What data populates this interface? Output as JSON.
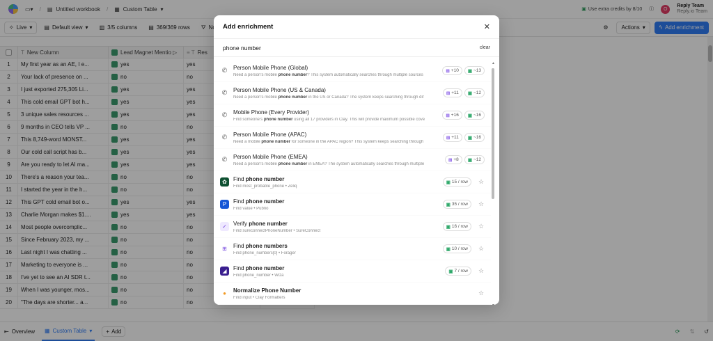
{
  "topbar": {
    "workbook": "Untitled workbook",
    "table": "Custom Table",
    "credits": "Use extra credits by 8/10",
    "account_name": "Reply Team",
    "account_sub": "Reply.io Team",
    "avatar_letter": "O"
  },
  "toolbar": {
    "live": "Live",
    "view": "Default view",
    "columns": "3/5 columns",
    "rows": "369/369 rows",
    "filter": "No f",
    "actions": "Actions",
    "add_enrichment": "Add enrichment"
  },
  "grid": {
    "headers": [
      "New Column",
      "Lead Magnet Mentio",
      "Res"
    ],
    "rows": [
      [
        "1",
        "My first year as an AE, I e...",
        "yes",
        "yes"
      ],
      [
        "2",
        "Your lack of presence on ...",
        "no",
        "no"
      ],
      [
        "3",
        "I just exported 275,305 Li...",
        "yes",
        "yes"
      ],
      [
        "4",
        "This cold email GPT bot h...",
        "yes",
        "yes"
      ],
      [
        "5",
        "3 unique sales resources ...",
        "yes",
        "yes"
      ],
      [
        "6",
        "9 months in CEO tells VP ...",
        "no",
        "no"
      ],
      [
        "7",
        "This 8,749-word MONST...",
        "yes",
        "yes"
      ],
      [
        "8",
        "Our cold call script has b...",
        "yes",
        "yes"
      ],
      [
        "9",
        "Are you ready to let AI ma...",
        "yes",
        "yes"
      ],
      [
        "10",
        "There's a reason your tea...",
        "no",
        "no"
      ],
      [
        "11",
        "I started the year in the h...",
        "no",
        "no"
      ],
      [
        "12",
        "This GPT cold email bot o...",
        "yes",
        "yes"
      ],
      [
        "13",
        "Charlie Morgan makes $1....",
        "yes",
        "yes"
      ],
      [
        "14",
        "Most people overcomplic...",
        "no",
        "no"
      ],
      [
        "15",
        "Since February 2023, my ...",
        "no",
        "no"
      ],
      [
        "16",
        "Last night I was chatting ...",
        "no",
        "no"
      ],
      [
        "17",
        "Marketing to everyone is ...",
        "no",
        "no"
      ],
      [
        "18",
        "I've yet to see an AI SDR t...",
        "no",
        "no"
      ],
      [
        "19",
        "When I was younger, mos...",
        "no",
        "no"
      ],
      [
        "20",
        "\"The days are shorter... a...",
        "no",
        "no"
      ]
    ]
  },
  "bottombar": {
    "overview": "Overview",
    "tab": "Custom Table",
    "add": "Add"
  },
  "modal": {
    "title": "Add enrichment",
    "search_value": "phone number",
    "clear": "clear",
    "items": [
      {
        "name": "Person Mobile Phone (Global)",
        "d1": "Need a person's mobile ",
        "dk": "phone number",
        "d2": "? This system automatically searches through multiple sources",
        "p1": "+10",
        "p2": "~13",
        "icon": "phone"
      },
      {
        "name": "Person Mobile Phone (US & Canada)",
        "d1": "Need a person's mobile ",
        "dk": "phone number",
        "d2": " in the US or Canada? The system keeps searching through dif",
        "p1": "+11",
        "p2": "~12",
        "icon": "phone"
      },
      {
        "name": "Mobile Phone (Every Provider)",
        "d1": "Find someone's ",
        "dk": "phone number",
        "d2": " using all 17 providers in Clay. This will provide maximum possible cove",
        "p1": "+16",
        "p2": "~16",
        "icon": "phone"
      },
      {
        "name": "Person Mobile Phone (APAC)",
        "d1": "Need a mobile ",
        "dk": "phone number",
        "d2": " for someone in the APAC region? This system keeps searching through",
        "p1": "+11",
        "p2": "~16",
        "icon": "phone"
      },
      {
        "name": "Person Mobile Phone (EMEA)",
        "d1": "Need a person's mobile ",
        "dk": "phone number",
        "d2": " in EMEA? The system automatically searches through multiple",
        "p1": "+8",
        "p2": "~12",
        "icon": "phone"
      },
      {
        "name_pre": "Find ",
        "name_k": "phone number",
        "desc": "Find most_probable_phone • Zeliq",
        "credits": "15 / row",
        "icon": "zeliq"
      },
      {
        "name_pre": "Find ",
        "name_k": "phone number",
        "desc": "Find value • Pubrio",
        "credits": "35 / row",
        "icon": "pubrio"
      },
      {
        "name_pre": "Verify ",
        "name_k": "phone number",
        "desc": "Find sureconnectPhoneNumber • SureConnect",
        "credits": "16 / row",
        "icon": "sureconnect"
      },
      {
        "name_pre": "Find ",
        "name_k": "phone numbers",
        "desc": "Find phone_numbers[0] • Forager",
        "credits": "10 / row",
        "icon": "forager"
      },
      {
        "name_pre": "Find ",
        "name_k": "phone number",
        "desc": "Find phone_number • Wiza",
        "credits": "7 / row",
        "icon": "wiza"
      },
      {
        "name_pre": "",
        "name_k": "Normalize Phone Number",
        "desc": "Find input • Clay Formatters",
        "credits": "",
        "icon": "clay"
      }
    ]
  }
}
